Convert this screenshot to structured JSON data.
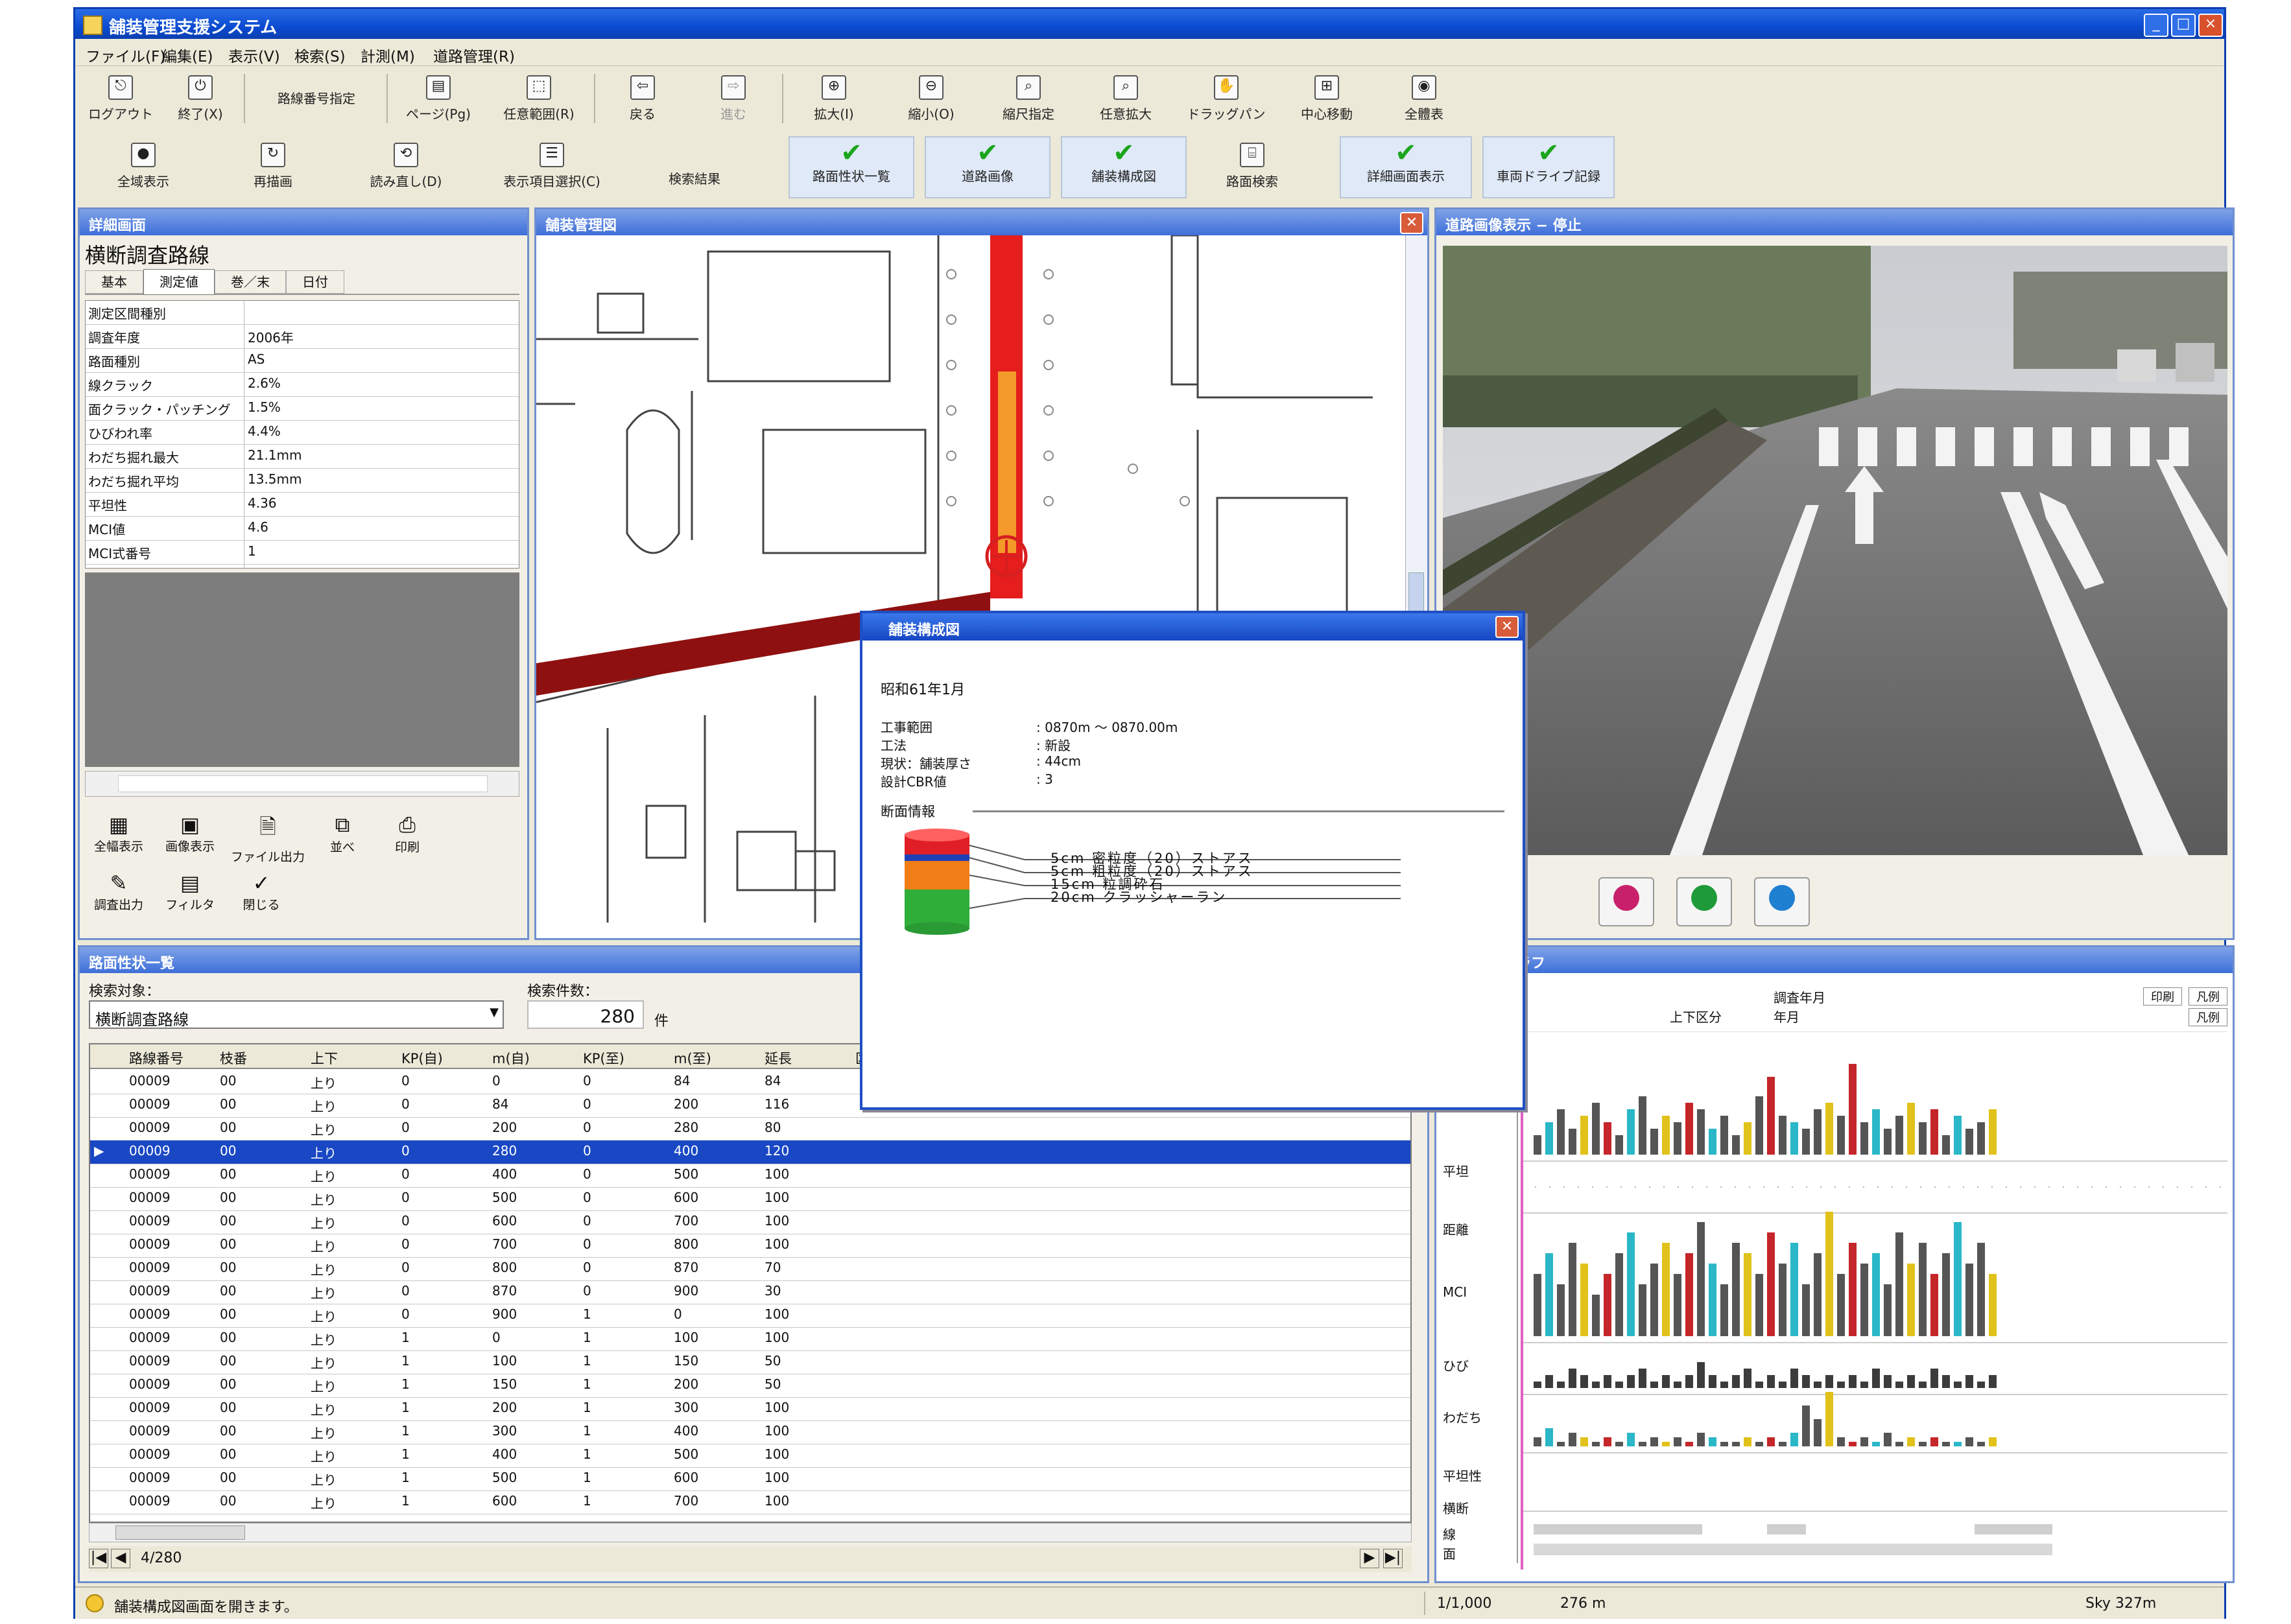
{
  "window": {
    "title": "舗装管理支援システム"
  },
  "menus": [
    "ファイル(F)",
    "編集(E)",
    "表示(V)",
    "検索(S)",
    "計測(M)",
    "道路管理(R)"
  ],
  "toolbar1": [
    {
      "label": "ログアウト",
      "icon": "logout-icon"
    },
    {
      "label": "終了(X)",
      "icon": "exit-icon"
    },
    {
      "label": "路線番号指定",
      "icon": "dropdown-icon"
    },
    {
      "label": "ページ(Pg)",
      "icon": "page-icon"
    },
    {
      "label": "任意範囲(R)",
      "icon": "range-icon"
    },
    {
      "label": "戻る",
      "icon": "back-icon"
    },
    {
      "label": "進む",
      "icon": "forward-icon"
    },
    {
      "label": "拡大(I)",
      "icon": "zoom-in-icon"
    },
    {
      "label": "縮小(O)",
      "icon": "zoom-out-icon"
    },
    {
      "label": "縮尺指定",
      "icon": "scale-icon"
    },
    {
      "label": "任意拡大",
      "icon": "zoom-rect-icon"
    },
    {
      "label": "ドラッグパン",
      "icon": "hand-icon"
    },
    {
      "label": "中心移動",
      "icon": "center-icon"
    },
    {
      "label": "全體表",
      "icon": "full-view-icon"
    }
  ],
  "toolbar2": [
    {
      "label": "全域表示",
      "icon": "globe-icon",
      "checked": false
    },
    {
      "label": "再描画",
      "icon": "redraw-icon",
      "checked": false
    },
    {
      "label": "読み直し(D)",
      "icon": "reload-icon",
      "checked": false
    },
    {
      "label": "表示項目選択(C)",
      "icon": "select-icon",
      "checked": false
    },
    {
      "label": "検索結果",
      "icon": "",
      "checked": false
    },
    {
      "label": "路面性状一覧",
      "icon": "check-icon",
      "checked": true
    },
    {
      "label": "道路画像",
      "icon": "check-icon",
      "checked": true
    },
    {
      "label": "舗装構成図",
      "icon": "check-icon",
      "checked": true
    },
    {
      "label": "路面検索",
      "icon": "search-icon",
      "checked": false
    },
    {
      "label": "詳細画面表示",
      "icon": "check-icon",
      "checked": true
    },
    {
      "label": "車両ドライブ記録",
      "icon": "check-icon",
      "checked": true
    }
  ],
  "detail_panel": {
    "title": "詳細画面",
    "subject": "横断調査路線",
    "tabs": [
      "基本",
      "測定値",
      "巻／末",
      "日付"
    ],
    "rows": [
      {
        "k": "測定区間種別",
        "v": ""
      },
      {
        "k": "調査年度",
        "v": "2006年"
      },
      {
        "k": "路面種別",
        "v": "AS"
      },
      {
        "k": "線クラック",
        "v": "2.6%"
      },
      {
        "k": "面クラック・パッチング",
        "v": "1.5%"
      },
      {
        "k": "ひびわれ率",
        "v": "4.4%"
      },
      {
        "k": "わだち掘れ最大",
        "v": "21.1mm"
      },
      {
        "k": "わだち掘れ平均",
        "v": "13.5mm"
      },
      {
        "k": "平坦性",
        "v": "4.36"
      },
      {
        "k": "MCI値",
        "v": "4.6"
      },
      {
        "k": "MCI式番号",
        "v": "1"
      }
    ],
    "buttons": [
      {
        "label": "全幅表示",
        "icon": "grid-icon"
      },
      {
        "label": "画像表示",
        "icon": "image-icon"
      },
      {
        "label": "ファイル出力",
        "icon": "file-icon"
      },
      {
        "label": "並べ",
        "icon": "arrange-icon"
      },
      {
        "label": "印刷",
        "icon": "print-icon"
      },
      {
        "label": "調査出力",
        "icon": "report-icon"
      },
      {
        "label": "フィルタ",
        "icon": "filter-icon"
      },
      {
        "label": "閉じる",
        "icon": "close-icon"
      }
    ]
  },
  "map_panel": {
    "title": "舗装管理図"
  },
  "image_panel": {
    "title": "道路画像表示 − 停止",
    "controls": [
      {
        "icon": "pause-icon",
        "color": "#c8206a"
      },
      {
        "icon": "play-icon",
        "color": "#1f9a3a"
      },
      {
        "icon": "stop-icon",
        "color": "#1f7fd0"
      }
    ]
  },
  "popup": {
    "title": "舗装構成図",
    "date": "昭和61年1月",
    "fields": [
      {
        "k": "工事範囲",
        "v": ": 0870m 〜 0870.00m"
      },
      {
        "k": "工法",
        "v": ": 新設"
      },
      {
        "k": "現状：舗装厚さ",
        "v": ": 44cm"
      },
      {
        "k": "設計CBR値",
        "v": ": 3"
      }
    ],
    "section_title": "断面情報",
    "layers": [
      {
        "label": "5cm 密粒度（20）ストアス",
        "color": "#e01e25"
      },
      {
        "label": "5cm 粗粒度（20）ストアス",
        "color": "#1d3fb8"
      },
      {
        "label": "15cm 粒調砕石",
        "color": "#f07d16"
      },
      {
        "label": "20cm クラッシャーラン",
        "color": "#2fae3a"
      }
    ]
  },
  "list_panel": {
    "title": "路面性状一覧",
    "search_target_label": "検索対象：",
    "search_target_value": "横断調査路線",
    "count_label": "検索件数：",
    "count_value": "280",
    "count_unit": "件",
    "columns": [
      "路線番号",
      "枝番",
      "上下",
      "KP(自)",
      "m(自)",
      "KP(至)",
      "m(至)",
      "延長",
      "区間",
      "",
      "",
      "",
      "",
      "",
      ""
    ],
    "rows": [
      [
        "00009",
        "00",
        "上り",
        "0",
        "0",
        "0",
        "84",
        "84"
      ],
      [
        "00009",
        "00",
        "上り",
        "0",
        "84",
        "0",
        "200",
        "116"
      ],
      [
        "00009",
        "00",
        "上り",
        "0",
        "200",
        "0",
        "280",
        "80"
      ],
      [
        "00009",
        "00",
        "上り",
        "0",
        "280",
        "0",
        "400",
        "120"
      ],
      [
        "00009",
        "00",
        "上り",
        "0",
        "400",
        "0",
        "500",
        "100"
      ],
      [
        "00009",
        "00",
        "上り",
        "0",
        "500",
        "0",
        "600",
        "100"
      ],
      [
        "00009",
        "00",
        "上り",
        "0",
        "600",
        "0",
        "700",
        "100"
      ],
      [
        "00009",
        "00",
        "上り",
        "0",
        "700",
        "0",
        "800",
        "100"
      ],
      [
        "00009",
        "00",
        "上り",
        "0",
        "800",
        "0",
        "870",
        "70"
      ],
      [
        "00009",
        "00",
        "上り",
        "0",
        "870",
        "0",
        "900",
        "30"
      ],
      [
        "00009",
        "00",
        "上り",
        "0",
        "900",
        "1",
        "0",
        "100"
      ],
      [
        "00009",
        "00",
        "上り",
        "1",
        "0",
        "1",
        "100",
        "100"
      ],
      [
        "00009",
        "00",
        "上り",
        "1",
        "100",
        "1",
        "150",
        "50"
      ],
      [
        "00009",
        "00",
        "上り",
        "1",
        "150",
        "1",
        "200",
        "50"
      ],
      [
        "00009",
        "00",
        "上り",
        "1",
        "200",
        "1",
        "300",
        "100"
      ],
      [
        "00009",
        "00",
        "上り",
        "1",
        "300",
        "1",
        "400",
        "100"
      ],
      [
        "00009",
        "00",
        "上り",
        "1",
        "400",
        "1",
        "500",
        "100"
      ],
      [
        "00009",
        "00",
        "上り",
        "1",
        "500",
        "1",
        "600",
        "100"
      ],
      [
        "00009",
        "00",
        "上り",
        "1",
        "600",
        "1",
        "700",
        "100"
      ]
    ],
    "selected_row": 3,
    "nav_text": "4/280"
  },
  "graph_panel": {
    "title": "路面性状グラフ",
    "header_texts": [
      "上下区分",
      "年月",
      "調査年月"
    ],
    "buttons": [
      "印刷",
      "凡例",
      "凡例"
    ],
    "row_labels": [
      "平坦",
      "距離",
      "MCI",
      "ひび",
      "わだち",
      "平坦性",
      "横断",
      "線",
      "面"
    ],
    "bars": {
      "row1": [
        3,
        5,
        7,
        4,
        6,
        8,
        5,
        3,
        7,
        9,
        4,
        6,
        5,
        8,
        7,
        4,
        6,
        3,
        5,
        9,
        12,
        6,
        5,
        4,
        7,
        8,
        6,
        14,
        5,
        7,
        4,
        6,
        8,
        5,
        7,
        3,
        6,
        4,
        5,
        7
      ],
      "row2": [
        6,
        8,
        5,
        9,
        7,
        4,
        6,
        8,
        10,
        5,
        7,
        9,
        6,
        8,
        11,
        7,
        5,
        9,
        8,
        6,
        10,
        7,
        9,
        5,
        8,
        12,
        6,
        9,
        7,
        8,
        5,
        10,
        7,
        9,
        6,
        8,
        11,
        7,
        9,
        6
      ],
      "row3": [
        1,
        2,
        1,
        3,
        2,
        1,
        2,
        1,
        2,
        3,
        1,
        2,
        1,
        2,
        4,
        2,
        1,
        2,
        3,
        1,
        2,
        1,
        3,
        2,
        1,
        2,
        1,
        2,
        1,
        3,
        2,
        1,
        2,
        1,
        3,
        2,
        1,
        2,
        1,
        2
      ],
      "row4": [
        2,
        4,
        1,
        3,
        2,
        1,
        2,
        1,
        3,
        1,
        2,
        1,
        2,
        1,
        3,
        2,
        1,
        1,
        2,
        1,
        2,
        1,
        3,
        9,
        6,
        12,
        2,
        1,
        2,
        1,
        3,
        1,
        2,
        1,
        2,
        1,
        1,
        2,
        1,
        2
      ]
    }
  },
  "status": {
    "message": "舗装構成図画面を開きます。",
    "scale": "1/1,000",
    "distance": "276 m",
    "coord": "Sky 327m"
  },
  "colors": {
    "xp_blue": "#0a3fb0",
    "panel_title": "#3e6fd8",
    "selection": "#1a48c4"
  }
}
